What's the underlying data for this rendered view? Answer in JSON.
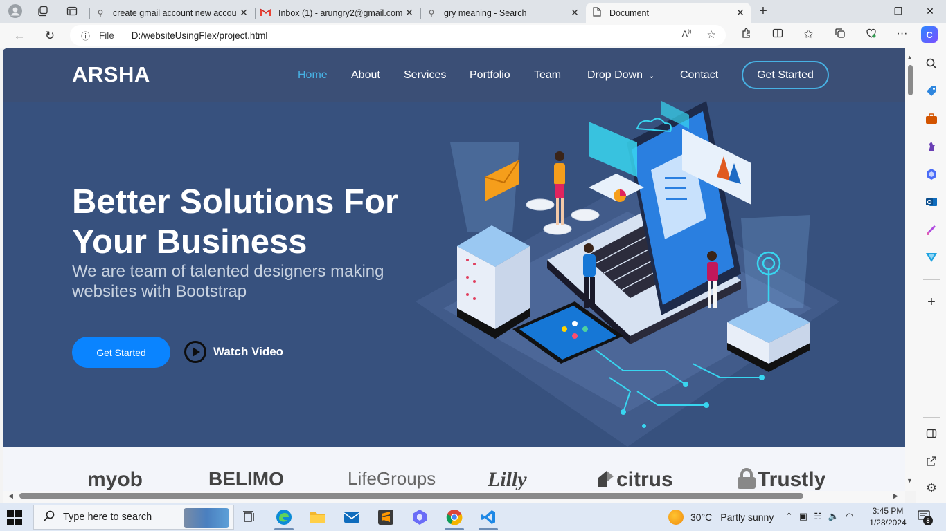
{
  "browser": {
    "tabs": [
      {
        "title": "create gmail account new accou",
        "icon": "search-icon"
      },
      {
        "title": "Inbox (1) - arungry2@gmail.com",
        "icon": "gmail-icon"
      },
      {
        "title": "gry meaning - Search",
        "icon": "search-icon"
      },
      {
        "title": "Document",
        "icon": "document-icon"
      }
    ],
    "file_label": "File",
    "url": "D:/websiteUsingFlex/project.html"
  },
  "site": {
    "logo": "ARSHA",
    "nav": [
      {
        "label": "Home"
      },
      {
        "label": "About"
      },
      {
        "label": "Services"
      },
      {
        "label": "Portfolio"
      },
      {
        "label": "Team"
      },
      {
        "label": "Drop Down"
      },
      {
        "label": "Contact"
      }
    ],
    "header_cta": "Get Started",
    "hero": {
      "title": "Better Solutions For Your Business",
      "subtitle": "We are team of talented designers making websites with Bootstrap",
      "primary_button": "Get Started",
      "video_link": "Watch Video"
    },
    "clients": [
      "myob",
      "BELIMO",
      "LifeGroups",
      "Lilly",
      "citrus",
      "Trustly"
    ]
  },
  "taskbar": {
    "search_placeholder": "Type here to search",
    "weather_temp": "30°C",
    "weather_text": "Partly sunny",
    "time": "3:45 PM",
    "date": "1/28/2024",
    "notifications": "8"
  },
  "colors": {
    "hero_bg": "#37517e",
    "accent": "#47b2e4",
    "primary_button": "#0a84ff"
  }
}
